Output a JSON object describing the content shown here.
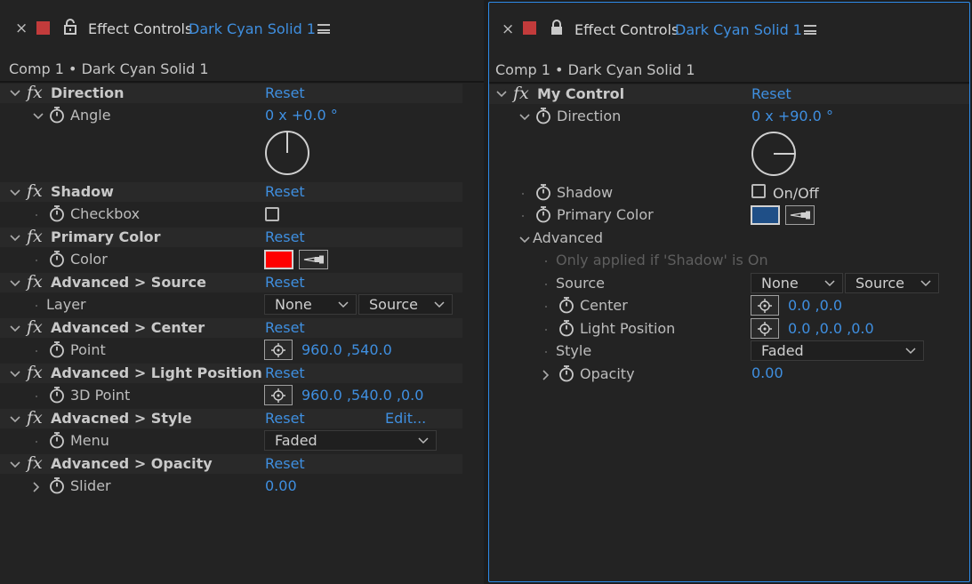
{
  "colors": {
    "accent": "#3f8fe0",
    "swatch_red": "#ff0000",
    "swatch_blue": "#1f4f87",
    "tab_square": "#c23b3b"
  },
  "left": {
    "tab": {
      "title": "Effect Controls",
      "layer": "Dark Cyan Solid 1"
    },
    "breadcrumb": "Comp 1 • Dark Cyan Solid 1",
    "direction": {
      "name": "Direction",
      "reset": "Reset",
      "param": "Angle",
      "value": "0 x +0.0 °"
    },
    "shadow": {
      "name": "Shadow",
      "reset": "Reset",
      "param": "Checkbox"
    },
    "primary_color": {
      "name": "Primary Color",
      "reset": "Reset",
      "param": "Color"
    },
    "source": {
      "name": "Advanced > Source",
      "reset": "Reset",
      "param": "Layer",
      "dropdown1": "None",
      "dropdown2": "Source"
    },
    "center": {
      "name": "Advanced > Center",
      "reset": "Reset",
      "param": "Point",
      "value": "960.0 ,540.0"
    },
    "light": {
      "name": "Advanced > Light Position",
      "reset": "Reset",
      "param": "3D Point",
      "value": "960.0 ,540.0 ,0.0"
    },
    "style": {
      "name": "Advacned > Style",
      "reset": "Reset",
      "edit": "Edit...",
      "param": "Menu",
      "dropdown": "Faded"
    },
    "opacity": {
      "name": "Advanced > Opacity",
      "reset": "Reset",
      "param": "Slider",
      "value": "0.00"
    }
  },
  "right": {
    "tab": {
      "title": "Effect Controls",
      "layer": "Dark Cyan Solid 1"
    },
    "breadcrumb": "Comp 1 • Dark Cyan Solid 1",
    "effect": {
      "name": "My Control",
      "reset": "Reset"
    },
    "direction": {
      "label": "Direction",
      "value": "0 x +90.0 °"
    },
    "shadow": {
      "label": "Shadow",
      "checkbox_label": "On/Off"
    },
    "primary_color": {
      "label": "Primary Color"
    },
    "advanced": {
      "label": "Advanced",
      "note": "Only applied if 'Shadow' is On"
    },
    "source": {
      "label": "Source",
      "dropdown1": "None",
      "dropdown2": "Source"
    },
    "center": {
      "label": "Center",
      "value": "0.0 ,0.0"
    },
    "light": {
      "label": "Light Position",
      "value": "0.0 ,0.0 ,0.0"
    },
    "style": {
      "label": "Style",
      "dropdown": "Faded"
    },
    "opacity": {
      "label": "Opacity",
      "value": "0.00"
    }
  }
}
